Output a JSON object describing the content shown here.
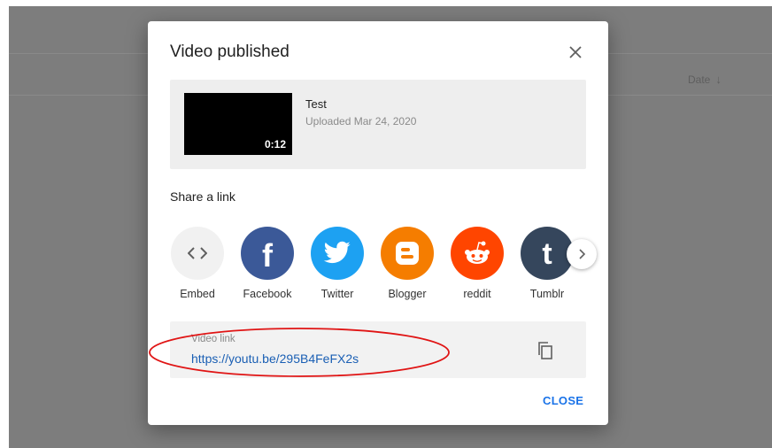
{
  "background": {
    "sort_column": "Date",
    "sort_icon": "arrow-down-icon"
  },
  "dialog": {
    "title": "Video published",
    "close_icon": "close-icon",
    "close_button": "CLOSE"
  },
  "video": {
    "title": "Test",
    "uploaded": "Uploaded Mar 24, 2020",
    "duration": "0:12"
  },
  "share": {
    "label": "Share a link",
    "items": [
      {
        "label": "Embed",
        "icon": "embed-icon",
        "color": "#f1f1f1"
      },
      {
        "label": "Facebook",
        "icon": "facebook-icon",
        "color": "#3b5998"
      },
      {
        "label": "Twitter",
        "icon": "twitter-icon",
        "color": "#1da1f2"
      },
      {
        "label": "Blogger",
        "icon": "blogger-icon",
        "color": "#f57d00"
      },
      {
        "label": "reddit",
        "icon": "reddit-icon",
        "color": "#ff4500"
      },
      {
        "label": "Tumblr",
        "icon": "tumblr-icon",
        "color": "#35465c"
      }
    ],
    "next_icon": "chevron-right-icon"
  },
  "link": {
    "label": "Video link",
    "url": "https://youtu.be/295B4FeFX2s",
    "copy_icon": "copy-icon"
  },
  "colors": {
    "accent": "#1a73e8",
    "link": "#1a5fb4",
    "annotation": "#e01414"
  }
}
